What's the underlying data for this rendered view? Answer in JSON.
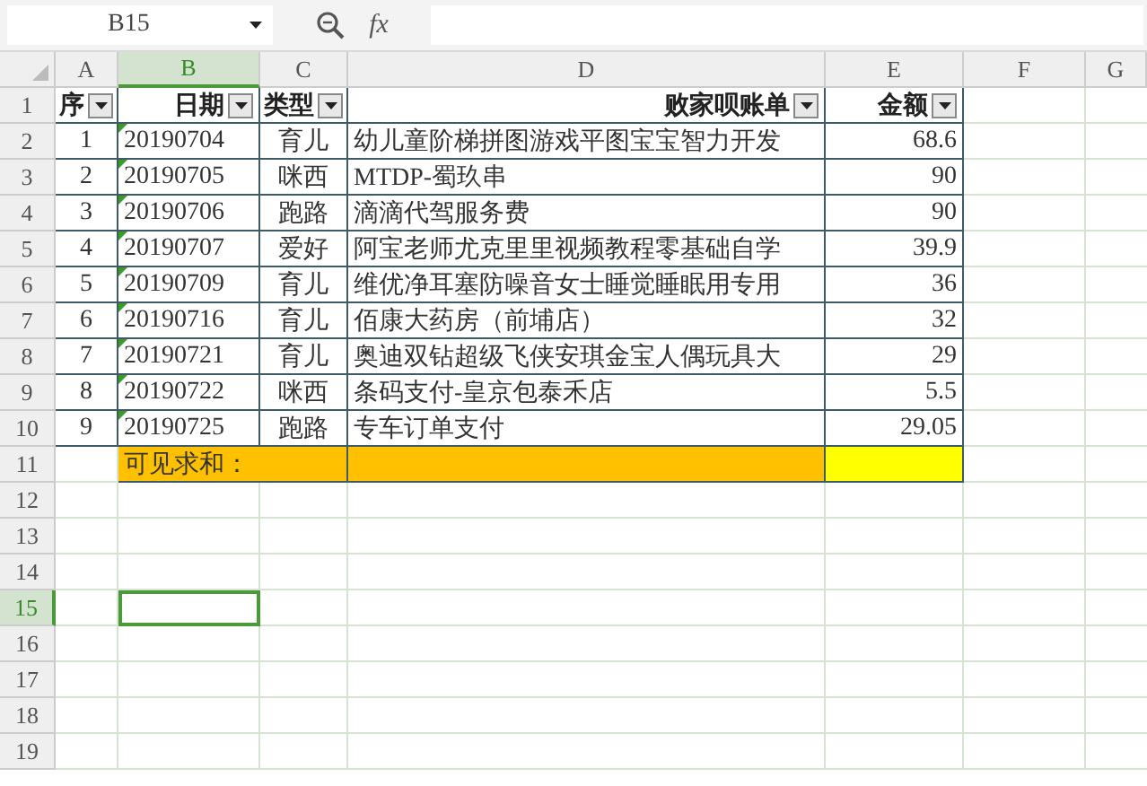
{
  "formula_bar": {
    "name_box": "B15",
    "function_label": "fx"
  },
  "columns": [
    {
      "label": "A",
      "selected": false
    },
    {
      "label": "B",
      "selected": true
    },
    {
      "label": "C",
      "selected": false
    },
    {
      "label": "D",
      "selected": false
    },
    {
      "label": "E",
      "selected": false
    },
    {
      "label": "F",
      "selected": false
    },
    {
      "label": "G",
      "selected": false
    }
  ],
  "row_numbers": [
    {
      "label": "1",
      "selected": false
    },
    {
      "label": "2",
      "selected": false
    },
    {
      "label": "3",
      "selected": false
    },
    {
      "label": "4",
      "selected": false
    },
    {
      "label": "5",
      "selected": false
    },
    {
      "label": "6",
      "selected": false
    },
    {
      "label": "7",
      "selected": false
    },
    {
      "label": "8",
      "selected": false
    },
    {
      "label": "9",
      "selected": false
    },
    {
      "label": "10",
      "selected": false
    },
    {
      "label": "11",
      "selected": false
    },
    {
      "label": "12",
      "selected": false
    },
    {
      "label": "13",
      "selected": false
    },
    {
      "label": "14",
      "selected": false
    },
    {
      "label": "15",
      "selected": true
    },
    {
      "label": "16",
      "selected": false
    },
    {
      "label": "17",
      "selected": false
    },
    {
      "label": "18",
      "selected": false
    },
    {
      "label": "19",
      "selected": false
    }
  ],
  "table_header": [
    "序",
    "日期",
    "类型",
    "败家呗账单",
    "金额"
  ],
  "table_rows": [
    {
      "seq": "1",
      "date": "20190704",
      "type": "育儿",
      "item": "幼儿童阶梯拼图游戏平图宝宝智力开发",
      "amount": "68.6"
    },
    {
      "seq": "2",
      "date": "20190705",
      "type": "咪西",
      "item": "MTDP-蜀玖串",
      "amount": "90"
    },
    {
      "seq": "3",
      "date": "20190706",
      "type": "跑路",
      "item": "滴滴代驾服务费",
      "amount": "90"
    },
    {
      "seq": "4",
      "date": "20190707",
      "type": "爱好",
      "item": "阿宝老师尤克里里视频教程零基础自学",
      "amount": "39.9"
    },
    {
      "seq": "5",
      "date": "20190709",
      "type": "育儿",
      "item": "维优净耳塞防噪音女士睡觉睡眠用专用",
      "amount": "36"
    },
    {
      "seq": "6",
      "date": "20190716",
      "type": "育儿",
      "item": "佰康大药房（前埔店）",
      "amount": "32"
    },
    {
      "seq": "7",
      "date": "20190721",
      "type": "育儿",
      "item": "奥迪双钻超级飞侠安琪金宝人偶玩具大",
      "amount": "29"
    },
    {
      "seq": "8",
      "date": "20190722",
      "type": "咪西",
      "item": "条码支付-皇京包泰禾店",
      "amount": "5.5"
    },
    {
      "seq": "9",
      "date": "20190725",
      "type": "跑路",
      "item": "专车订单支付",
      "amount": "29.05"
    }
  ],
  "total_row": {
    "label": "可见求和："
  }
}
